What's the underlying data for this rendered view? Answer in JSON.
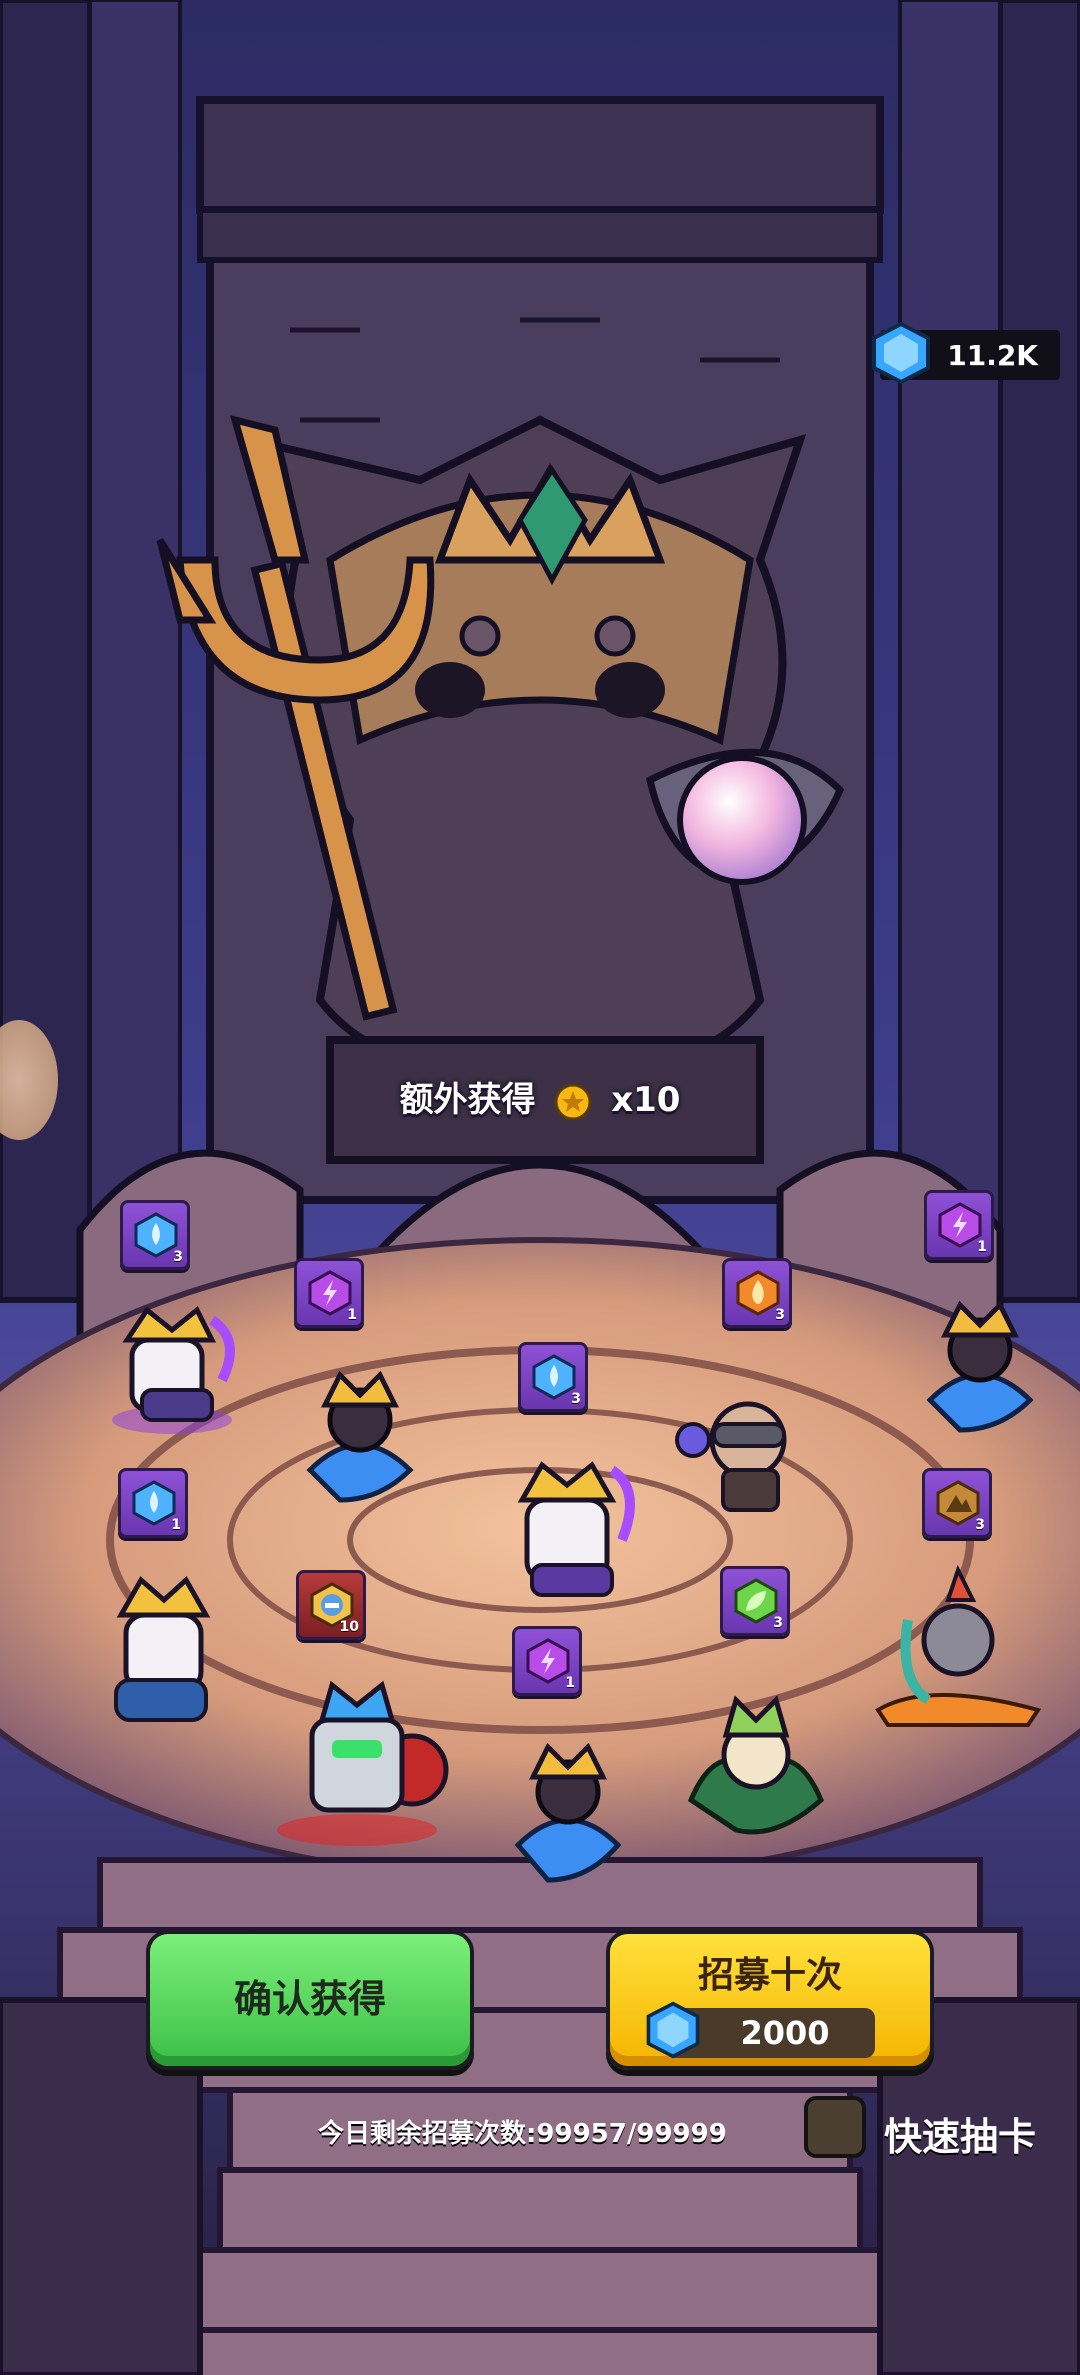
{
  "currency": {
    "gems": "11.2K"
  },
  "bonus": {
    "label": "额外获得",
    "amount": "x10"
  },
  "items": [
    {
      "name": "water-gem-badge",
      "type": "water",
      "count": "3"
    },
    {
      "name": "lightning-gem-badge",
      "type": "lightning",
      "count": "1"
    },
    {
      "name": "fire-gem-badge",
      "type": "fire",
      "count": "3"
    },
    {
      "name": "lightning-gem-badge",
      "type": "lightning",
      "count": "1"
    },
    {
      "name": "water-gem-badge",
      "type": "water",
      "count": "3"
    },
    {
      "name": "water-gem-badge",
      "type": "water",
      "count": "1"
    },
    {
      "name": "earth-gem-badge",
      "type": "earth",
      "count": "3"
    },
    {
      "name": "hero-shard-badge",
      "type": "shard",
      "count": "10"
    },
    {
      "name": "nature-gem-badge",
      "type": "nature",
      "count": "3"
    },
    {
      "name": "lightning-gem-badge",
      "type": "lightning",
      "count": "1"
    }
  ],
  "buttons": {
    "confirm": "确认获得",
    "recruit_ten": "招募十次",
    "recruit_cost": "2000"
  },
  "footer": {
    "remaining_label": "今日剩余招募次数:99957/99999",
    "quick_draw_label": "快速抽卡"
  },
  "colors": {
    "green_button": "#4fd957",
    "yellow_button": "#ffcd10",
    "badge_purple": "#8e51d6",
    "badge_red": "#9a2b2e"
  }
}
